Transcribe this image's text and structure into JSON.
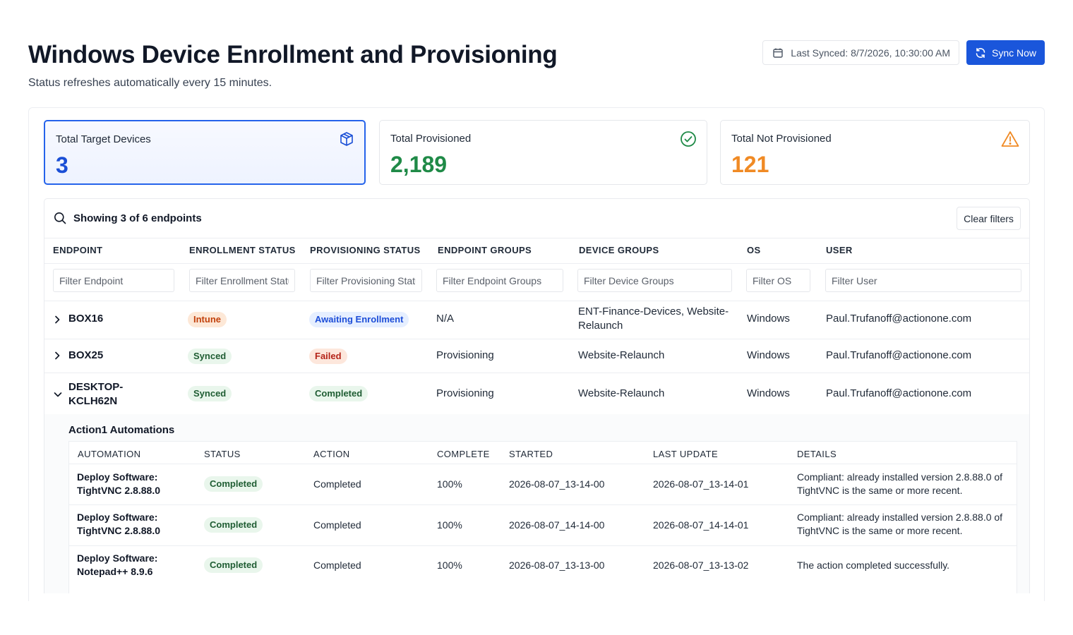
{
  "header": {
    "title": "Windows Device Enrollment and Provisioning",
    "subtitle": "Status refreshes automatically every 15 minutes.",
    "last_synced": "Last Synced: 8/7/2026, 10:30:00 AM",
    "sync_button": "Sync Now"
  },
  "cards": [
    {
      "label": "Total Target Devices",
      "value": "3",
      "color": "#1a4fd6",
      "icon": "cube-icon"
    },
    {
      "label": "Total Provisioned",
      "value": "2,189",
      "color": "#1f8a47",
      "icon": "check-circle-icon"
    },
    {
      "label": "Total Not Provisioned",
      "value": "121",
      "color": "#f08a24",
      "icon": "warning-icon"
    }
  ],
  "table": {
    "showing": "Showing 3 of 6 endpoints",
    "clear_filters": "Clear filters",
    "columns": [
      "ENDPOINT",
      "ENROLLMENT STATUS",
      "PROVISIONING STATUS",
      "ENDPOINT GROUPS",
      "DEVICE GROUPS",
      "OS",
      "USER"
    ],
    "filters": [
      "Filter Endpoint",
      "Filter Enrollment Status",
      "Filter Provisioning Status",
      "Filter Endpoint Groups",
      "Filter Device Groups",
      "Filter OS",
      "Filter User"
    ],
    "rows": [
      {
        "endpoint": "BOX16",
        "enrollment": "Intune",
        "provisioning": "Awaiting Enrollment",
        "endpoint_groups": "N/A",
        "device_groups": "ENT-Finance-Devices, Website-Relaunch",
        "os": "Windows",
        "user": "Paul.Trufanoff@actionone.com"
      },
      {
        "endpoint": "BOX25",
        "enrollment": "Synced",
        "provisioning": "Failed",
        "endpoint_groups": "Provisioning",
        "device_groups": "Website-Relaunch",
        "os": "Windows",
        "user": "Paul.Trufanoff@actionone.com"
      },
      {
        "endpoint": "DESKTOP-KCLH62N",
        "enrollment": "Synced",
        "provisioning": "Completed",
        "endpoint_groups": "Provisioning",
        "device_groups": "Website-Relaunch",
        "os": "Windows",
        "user": "Paul.Trufanoff@actionone.com"
      }
    ]
  },
  "automations": {
    "title": "Action1 Automations",
    "columns": [
      "AUTOMATION",
      "STATUS",
      "ACTION",
      "COMPLETE",
      "STARTED",
      "LAST UPDATE",
      "DETAILS"
    ],
    "rows": [
      {
        "name": "Deploy Software: TightVNC 2.8.88.0",
        "status": "Completed",
        "action": "Completed",
        "complete": "100%",
        "started": "2026-08-07_13-14-00",
        "last_update": "2026-08-07_13-14-01",
        "details": "Compliant: already installed version 2.8.88.0 of TightVNC is the same or more recent."
      },
      {
        "name": "Deploy Software: TightVNC 2.8.88.0",
        "status": "Completed",
        "action": "Completed",
        "complete": "100%",
        "started": "2026-08-07_14-14-00",
        "last_update": "2026-08-07_14-14-01",
        "details": "Compliant: already installed version 2.8.88.0 of TightVNC is the same or more recent."
      },
      {
        "name": "Deploy Software: Notepad++ 8.9.6",
        "status": "Completed",
        "action": "Completed",
        "complete": "100%",
        "started": "2026-08-07_13-13-00",
        "last_update": "2026-08-07_13-13-02",
        "details": "The action completed successfully."
      }
    ]
  }
}
